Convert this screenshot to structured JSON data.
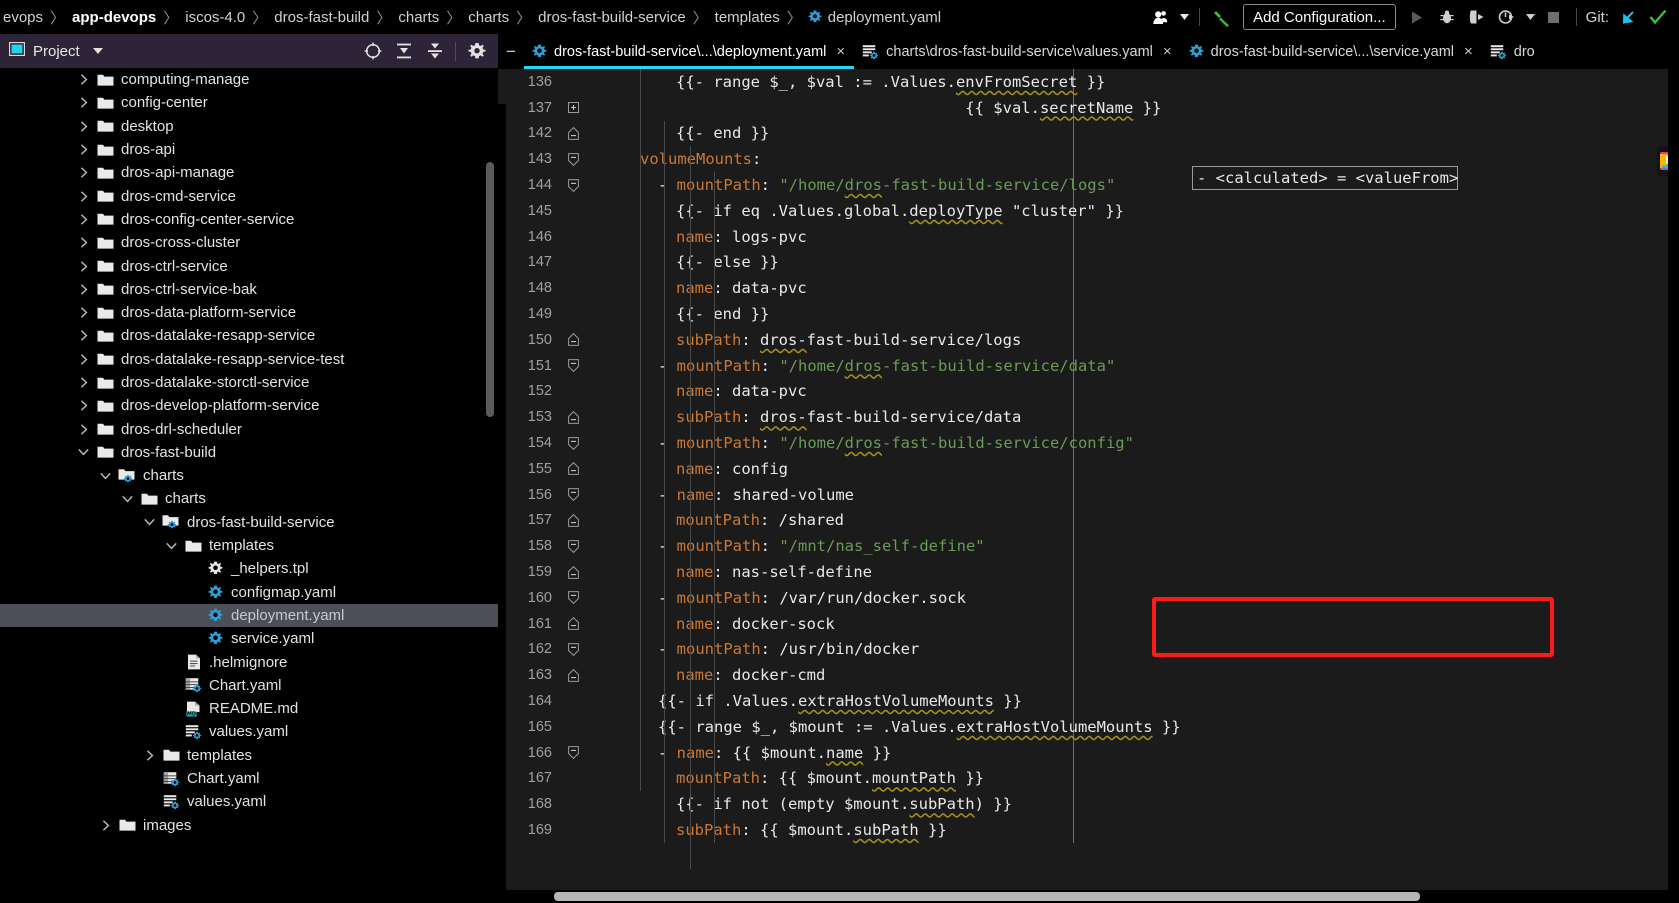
{
  "breadcrumb": {
    "items": [
      {
        "label": "evops",
        "bold": false
      },
      {
        "label": "app-devops",
        "bold": true
      },
      {
        "label": "iscos-4.0",
        "bold": false
      },
      {
        "label": "dros-fast-build",
        "bold": false
      },
      {
        "label": "charts",
        "bold": false
      },
      {
        "label": "charts",
        "bold": false
      },
      {
        "label": "dros-fast-build-service",
        "bold": false
      },
      {
        "label": "templates",
        "bold": false
      }
    ],
    "separator": "〉",
    "file": "deployment.yaml",
    "file_icon": "yaml-gear-icon"
  },
  "toolbar": {
    "user_icon": "user-avatar-icon",
    "user_caret": "▾",
    "build_icon": "build-hammer-icon",
    "add_configuration_label": "Add Configuration...",
    "run_icon": "run-play-icon",
    "debug_icon": "debug-bug-icon",
    "run_coverage_icon": "run-with-coverage-icon",
    "profile_icon": "profiler-icon",
    "more_caret": "▾",
    "stop_icon": "stop-square-icon",
    "git_label": "Git:",
    "git_update_icon": "git-update-arrow-icon",
    "git_commit_icon": "git-commit-check-icon"
  },
  "project_panel": {
    "title": "Project",
    "title_icon": "project-view-icon",
    "caret": "▾",
    "actions": [
      {
        "name": "select-opened-file-icon",
        "glyph": "⊕"
      },
      {
        "name": "expand-all-icon",
        "glyph": "⤓"
      },
      {
        "name": "collapse-all-icon",
        "glyph": "⤒"
      },
      {
        "name": "settings-gear-icon",
        "glyph": "⚙"
      }
    ],
    "tree": [
      {
        "label": "computing-manage",
        "depth": 1,
        "icon": "folder",
        "arrow": "right",
        "selected": false
      },
      {
        "label": "config-center",
        "depth": 1,
        "icon": "folder",
        "arrow": "right",
        "selected": false
      },
      {
        "label": "desktop",
        "depth": 1,
        "icon": "folder",
        "arrow": "right",
        "selected": false
      },
      {
        "label": "dros-api",
        "depth": 1,
        "icon": "folder",
        "arrow": "right",
        "selected": false
      },
      {
        "label": "dros-api-manage",
        "depth": 1,
        "icon": "folder",
        "arrow": "right",
        "selected": false
      },
      {
        "label": "dros-cmd-service",
        "depth": 1,
        "icon": "folder",
        "arrow": "right",
        "selected": false
      },
      {
        "label": "dros-config-center-service",
        "depth": 1,
        "icon": "folder",
        "arrow": "right",
        "selected": false
      },
      {
        "label": "dros-cross-cluster",
        "depth": 1,
        "icon": "folder",
        "arrow": "right",
        "selected": false
      },
      {
        "label": "dros-ctrl-service",
        "depth": 1,
        "icon": "folder",
        "arrow": "right",
        "selected": false
      },
      {
        "label": "dros-ctrl-service-bak",
        "depth": 1,
        "icon": "folder",
        "arrow": "right",
        "selected": false
      },
      {
        "label": "dros-data-platform-service",
        "depth": 1,
        "icon": "folder",
        "arrow": "right",
        "selected": false
      },
      {
        "label": "dros-datalake-resapp-service",
        "depth": 1,
        "icon": "folder",
        "arrow": "right",
        "selected": false
      },
      {
        "label": "dros-datalake-resapp-service-test",
        "depth": 1,
        "icon": "folder",
        "arrow": "right",
        "selected": false
      },
      {
        "label": "dros-datalake-storctl-service",
        "depth": 1,
        "icon": "folder",
        "arrow": "right",
        "selected": false
      },
      {
        "label": "dros-develop-platform-service",
        "depth": 1,
        "icon": "folder",
        "arrow": "right",
        "selected": false
      },
      {
        "label": "dros-drl-scheduler",
        "depth": 1,
        "icon": "folder",
        "arrow": "right",
        "selected": false
      },
      {
        "label": "dros-fast-build",
        "depth": 1,
        "icon": "folder",
        "arrow": "down",
        "selected": false
      },
      {
        "label": "charts",
        "depth": 2,
        "icon": "helm-folder",
        "arrow": "down",
        "selected": false
      },
      {
        "label": "charts",
        "depth": 3,
        "icon": "folder",
        "arrow": "down",
        "selected": false
      },
      {
        "label": "dros-fast-build-service",
        "depth": 4,
        "icon": "helm-folder",
        "arrow": "down",
        "selected": false
      },
      {
        "label": "templates",
        "depth": 5,
        "icon": "folder",
        "arrow": "down",
        "selected": false
      },
      {
        "label": "_helpers.tpl",
        "depth": 6,
        "icon": "tpl-gear",
        "arrow": "none",
        "selected": false
      },
      {
        "label": "configmap.yaml",
        "depth": 6,
        "icon": "yaml-gear",
        "arrow": "none",
        "selected": false
      },
      {
        "label": "deployment.yaml",
        "depth": 6,
        "icon": "yaml-gear",
        "arrow": "none",
        "selected": true
      },
      {
        "label": "service.yaml",
        "depth": 6,
        "icon": "yaml-gear",
        "arrow": "none",
        "selected": false
      },
      {
        "label": ".helmignore",
        "depth": 5,
        "icon": "text-file",
        "arrow": "none",
        "selected": false
      },
      {
        "label": "Chart.yaml",
        "depth": 5,
        "icon": "chart-yaml",
        "arrow": "none",
        "selected": false
      },
      {
        "label": "README.md",
        "depth": 5,
        "icon": "markdown",
        "arrow": "none",
        "selected": false
      },
      {
        "label": "values.yaml",
        "depth": 5,
        "icon": "values-yaml",
        "arrow": "none",
        "selected": false
      },
      {
        "label": "templates",
        "depth": 4,
        "icon": "folder",
        "arrow": "right",
        "selected": false
      },
      {
        "label": "Chart.yaml",
        "depth": 4,
        "icon": "chart-yaml",
        "arrow": "none",
        "selected": false
      },
      {
        "label": "values.yaml",
        "depth": 4,
        "icon": "values-yaml",
        "arrow": "none",
        "selected": false
      },
      {
        "label": "images",
        "depth": 2,
        "icon": "folder",
        "arrow": "right",
        "selected": false
      }
    ]
  },
  "editor": {
    "collapse_glyph": "−",
    "tabs": [
      {
        "label": "dros-fast-build-service\\...\\deployment.yaml",
        "icon": "yaml-gear-icon",
        "active": true,
        "closable": true
      },
      {
        "label": "charts\\dros-fast-build-service\\values.yaml",
        "icon": "values-yaml-icon",
        "active": false,
        "closable": true
      },
      {
        "label": "dros-fast-build-service\\...\\service.yaml",
        "icon": "yaml-gear-icon",
        "active": false,
        "closable": true
      },
      {
        "label": "dro",
        "icon": "values-yaml-icon",
        "active": false,
        "closable": false
      }
    ],
    "close_glyph": "×",
    "folded_placeholder": "- <calculated> = <valueFrom>",
    "annotation": {
      "color": "#ff1a1a",
      "shape": "rectangle",
      "name": "red-highlight-box"
    },
    "lines": [
      {
        "num": "136",
        "fold": "none",
        "indent": 2,
        "tokens": [
          {
            "t": "{{- range $_, $val := .Values.",
            "c": "t"
          },
          {
            "t": "envFromSecret",
            "c": "t sq"
          },
          {
            "t": " }}",
            "c": "t"
          }
        ]
      },
      {
        "num": "137",
        "fold": "collapsed",
        "indent": 2,
        "tokens": [
          {
            "t": "                               ",
            "c": "t"
          },
          {
            "t": "{{ $val.",
            "c": "t"
          },
          {
            "t": "secretName",
            "c": "t sq"
          },
          {
            "t": " }}",
            "c": "t"
          }
        ]
      },
      {
        "num": "142",
        "fold": "end",
        "indent": 2,
        "tokens": [
          {
            "t": "{{- end }}",
            "c": "t"
          }
        ]
      },
      {
        "num": "143",
        "fold": "start",
        "indent": 0,
        "tokens": [
          {
            "t": "volumeMounts",
            "c": "k"
          },
          {
            "t": ":",
            "c": "v"
          }
        ]
      },
      {
        "num": "144",
        "fold": "start",
        "indent": 1,
        "tokens": [
          {
            "t": "- ",
            "c": "d"
          },
          {
            "t": "mountPath",
            "c": "k"
          },
          {
            "t": ": ",
            "c": "v"
          },
          {
            "t": "\"/home/",
            "c": "s"
          },
          {
            "t": "dros",
            "c": "s sq"
          },
          {
            "t": "-fast-build-service/logs\"",
            "c": "s"
          }
        ]
      },
      {
        "num": "145",
        "fold": "none",
        "indent": 2,
        "tokens": [
          {
            "t": "{{- if eq .Values.global.",
            "c": "t"
          },
          {
            "t": "deployType",
            "c": "t sq"
          },
          {
            "t": " \"cluster\" }}",
            "c": "t"
          }
        ]
      },
      {
        "num": "146",
        "fold": "none",
        "indent": 2,
        "tokens": [
          {
            "t": "name",
            "c": "k"
          },
          {
            "t": ": ",
            "c": "v"
          },
          {
            "t": "logs-pvc",
            "c": "v"
          }
        ]
      },
      {
        "num": "147",
        "fold": "none",
        "indent": 2,
        "tokens": [
          {
            "t": "{{- else }}",
            "c": "t"
          }
        ]
      },
      {
        "num": "148",
        "fold": "none",
        "indent": 2,
        "tokens": [
          {
            "t": "name",
            "c": "k"
          },
          {
            "t": ": ",
            "c": "v"
          },
          {
            "t": "data-pvc",
            "c": "v"
          }
        ]
      },
      {
        "num": "149",
        "fold": "none",
        "indent": 2,
        "tokens": [
          {
            "t": "{{- end }}",
            "c": "t"
          }
        ]
      },
      {
        "num": "150",
        "fold": "end",
        "indent": 2,
        "tokens": [
          {
            "t": "subPath",
            "c": "k"
          },
          {
            "t": ": ",
            "c": "v"
          },
          {
            "t": "dros-",
            "c": "v sq"
          },
          {
            "t": "fast-build-service/logs",
            "c": "v"
          }
        ]
      },
      {
        "num": "151",
        "fold": "start",
        "indent": 1,
        "tokens": [
          {
            "t": "- ",
            "c": "d"
          },
          {
            "t": "mountPath",
            "c": "k"
          },
          {
            "t": ": ",
            "c": "v"
          },
          {
            "t": "\"/home/",
            "c": "s"
          },
          {
            "t": "dros",
            "c": "s sq"
          },
          {
            "t": "-fast-build-service/data\"",
            "c": "s"
          }
        ]
      },
      {
        "num": "152",
        "fold": "none",
        "indent": 2,
        "tokens": [
          {
            "t": "name",
            "c": "k"
          },
          {
            "t": ": ",
            "c": "v"
          },
          {
            "t": "data-pvc",
            "c": "v"
          }
        ]
      },
      {
        "num": "153",
        "fold": "end",
        "indent": 2,
        "tokens": [
          {
            "t": "subPath",
            "c": "k"
          },
          {
            "t": ": ",
            "c": "v"
          },
          {
            "t": "dros-",
            "c": "v sq"
          },
          {
            "t": "fast-build-service/data",
            "c": "v"
          }
        ]
      },
      {
        "num": "154",
        "fold": "start",
        "indent": 1,
        "tokens": [
          {
            "t": "- ",
            "c": "d"
          },
          {
            "t": "mountPath",
            "c": "k"
          },
          {
            "t": ": ",
            "c": "v"
          },
          {
            "t": "\"/home/",
            "c": "s"
          },
          {
            "t": "dros",
            "c": "s sq"
          },
          {
            "t": "-fast-build-service/config\"",
            "c": "s"
          }
        ]
      },
      {
        "num": "155",
        "fold": "end",
        "indent": 2,
        "tokens": [
          {
            "t": "name",
            "c": "k"
          },
          {
            "t": ": ",
            "c": "v"
          },
          {
            "t": "config",
            "c": "v"
          }
        ]
      },
      {
        "num": "156",
        "fold": "start",
        "indent": 1,
        "tokens": [
          {
            "t": "- ",
            "c": "d"
          },
          {
            "t": "name",
            "c": "k"
          },
          {
            "t": ": ",
            "c": "v"
          },
          {
            "t": "shared-volume",
            "c": "v"
          }
        ]
      },
      {
        "num": "157",
        "fold": "end",
        "indent": 2,
        "tokens": [
          {
            "t": "mountPath",
            "c": "k"
          },
          {
            "t": ": ",
            "c": "v"
          },
          {
            "t": "/shared",
            "c": "v"
          }
        ]
      },
      {
        "num": "158",
        "fold": "start",
        "indent": 1,
        "tokens": [
          {
            "t": "- ",
            "c": "d"
          },
          {
            "t": "mountPath",
            "c": "k"
          },
          {
            "t": ": ",
            "c": "v"
          },
          {
            "t": "\"/mnt/nas_self-define\"",
            "c": "s"
          }
        ]
      },
      {
        "num": "159",
        "fold": "end",
        "indent": 2,
        "tokens": [
          {
            "t": "name",
            "c": "k"
          },
          {
            "t": ": ",
            "c": "v"
          },
          {
            "t": "nas-self-define",
            "c": "v"
          }
        ]
      },
      {
        "num": "160",
        "fold": "start",
        "indent": 1,
        "tokens": [
          {
            "t": "- ",
            "c": "d"
          },
          {
            "t": "mountPath",
            "c": "k"
          },
          {
            "t": ": ",
            "c": "v"
          },
          {
            "t": "/var/run/docker.sock",
            "c": "v"
          }
        ]
      },
      {
        "num": "161",
        "fold": "end",
        "indent": 2,
        "tokens": [
          {
            "t": "name",
            "c": "k"
          },
          {
            "t": ": ",
            "c": "v"
          },
          {
            "t": "docker-sock",
            "c": "v"
          }
        ]
      },
      {
        "num": "162",
        "fold": "start",
        "indent": 1,
        "tokens": [
          {
            "t": "- ",
            "c": "d"
          },
          {
            "t": "mountPath",
            "c": "k"
          },
          {
            "t": ": ",
            "c": "v"
          },
          {
            "t": "/usr/bin/docker",
            "c": "v"
          }
        ]
      },
      {
        "num": "163",
        "fold": "end",
        "indent": 2,
        "tokens": [
          {
            "t": "name",
            "c": "k"
          },
          {
            "t": ": ",
            "c": "v"
          },
          {
            "t": "docker-cmd",
            "c": "v"
          }
        ]
      },
      {
        "num": "164",
        "fold": "none",
        "indent": 1,
        "tokens": [
          {
            "t": "{{- if .Values.",
            "c": "t"
          },
          {
            "t": "extraHostVolumeMounts",
            "c": "t sq"
          },
          {
            "t": " }}",
            "c": "t"
          }
        ]
      },
      {
        "num": "165",
        "fold": "none",
        "indent": 1,
        "tokens": [
          {
            "t": "{{- range $_, $mount := .Values.",
            "c": "t"
          },
          {
            "t": "extraHostVolumeMounts",
            "c": "t sq"
          },
          {
            "t": " }}",
            "c": "t"
          }
        ]
      },
      {
        "num": "166",
        "fold": "start",
        "indent": 1,
        "tokens": [
          {
            "t": "- ",
            "c": "d"
          },
          {
            "t": "name",
            "c": "k"
          },
          {
            "t": ": ",
            "c": "v"
          },
          {
            "t": "{{ $mount.",
            "c": "t"
          },
          {
            "t": "name",
            "c": "t sq"
          },
          {
            "t": " }}",
            "c": "t"
          }
        ]
      },
      {
        "num": "167",
        "fold": "none",
        "indent": 2,
        "tokens": [
          {
            "t": "mountPath",
            "c": "k"
          },
          {
            "t": ": ",
            "c": "v"
          },
          {
            "t": "{{ $mount.",
            "c": "t"
          },
          {
            "t": "mountPath",
            "c": "t sq"
          },
          {
            "t": " }}",
            "c": "t"
          }
        ]
      },
      {
        "num": "168",
        "fold": "none",
        "indent": 2,
        "tokens": [
          {
            "t": "{{- if not (empty $mount.",
            "c": "t"
          },
          {
            "t": "subPath",
            "c": "t sq"
          },
          {
            "t": ") }}",
            "c": "t"
          }
        ]
      },
      {
        "num": "169",
        "fold": "none",
        "indent": 2,
        "tokens": [
          {
            "t": "subPath",
            "c": "k"
          },
          {
            "t": ": ",
            "c": "v"
          },
          {
            "t": "{{ $mount.",
            "c": "t"
          },
          {
            "t": "subPath",
            "c": "t sq"
          },
          {
            "t": " }}",
            "c": "t"
          }
        ]
      }
    ]
  }
}
